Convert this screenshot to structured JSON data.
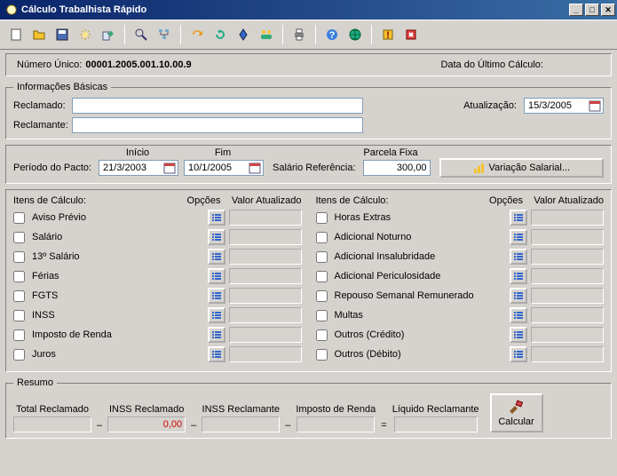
{
  "window": {
    "title": "Cálculo Trabalhista Rápido"
  },
  "infobar": {
    "numLabel": "Número Único:",
    "numValue": "00001.2005.001.10.00.9",
    "dateLabel": "Data do Último Cálculo:",
    "dateValue": ""
  },
  "basic": {
    "legend": "Informações Básicas",
    "reclamadoLabel": "Reclamado:",
    "reclamadoValue": "",
    "reclamanteLabel": "Reclamante:",
    "reclamanteValue": "",
    "atualizacaoLabel": "Atualização:",
    "atualizacaoValue": "15/3/2005"
  },
  "pacto": {
    "periodoLabel": "Período do Pacto:",
    "inicioLabel": "Início",
    "inicioValue": "21/3/2003",
    "fimLabel": "Fim",
    "fimValue": "10/1/2005",
    "salarioLabel": "Salário Referência:",
    "parcelaLabel": "Parcela Fixa",
    "parcelaValue": "300,00",
    "varButton": "Variação Salarial..."
  },
  "items": {
    "hdr1": "Itens de Cálculo:",
    "hdr2": "Opções",
    "hdr3": "Valor Atualizado",
    "left": [
      {
        "name": "Aviso Prévio",
        "checked": false,
        "value": ""
      },
      {
        "name": "Salário",
        "checked": false,
        "value": ""
      },
      {
        "name": "13º Salário",
        "checked": false,
        "value": ""
      },
      {
        "name": "Férias",
        "checked": false,
        "value": ""
      },
      {
        "name": "FGTS",
        "checked": false,
        "value": ""
      },
      {
        "name": "INSS",
        "checked": false,
        "value": ""
      },
      {
        "name": "Imposto de Renda",
        "checked": false,
        "value": ""
      },
      {
        "name": "Juros",
        "checked": false,
        "value": ""
      }
    ],
    "right": [
      {
        "name": "Horas Extras",
        "checked": false,
        "value": ""
      },
      {
        "name": "Adicional Noturno",
        "checked": false,
        "value": ""
      },
      {
        "name": "Adicional Insalubridade",
        "checked": false,
        "value": ""
      },
      {
        "name": "Adicional Periculosidade",
        "checked": false,
        "value": ""
      },
      {
        "name": "Repouso Semanal Remunerado",
        "checked": false,
        "value": ""
      },
      {
        "name": "Multas",
        "checked": false,
        "value": ""
      },
      {
        "name": "Outros (Crédito)",
        "checked": false,
        "value": ""
      },
      {
        "name": "Outros (Débito)",
        "checked": false,
        "value": ""
      }
    ]
  },
  "resumo": {
    "legend": "Resumo",
    "totalLabel": "Total Reclamado",
    "totalValue": "",
    "inssReclamadoLabel": "INSS Reclamado",
    "inssReclamadoValue": "0,00",
    "inssReclamanteLabel": "INSS Reclamante",
    "inssReclamanteValue": "",
    "impostoLabel": "Imposto de Renda",
    "impostoValue": "",
    "liquidoLabel": "Líquido Reclamante",
    "liquidoValue": "",
    "calcButton": "Calcular"
  },
  "toolbarIcons": [
    "new",
    "open",
    "save",
    "wizard",
    "export",
    "zoom",
    "tree",
    "redo",
    "refresh",
    "diamond",
    "people",
    "print",
    "help",
    "globe",
    "warn",
    "exit"
  ]
}
